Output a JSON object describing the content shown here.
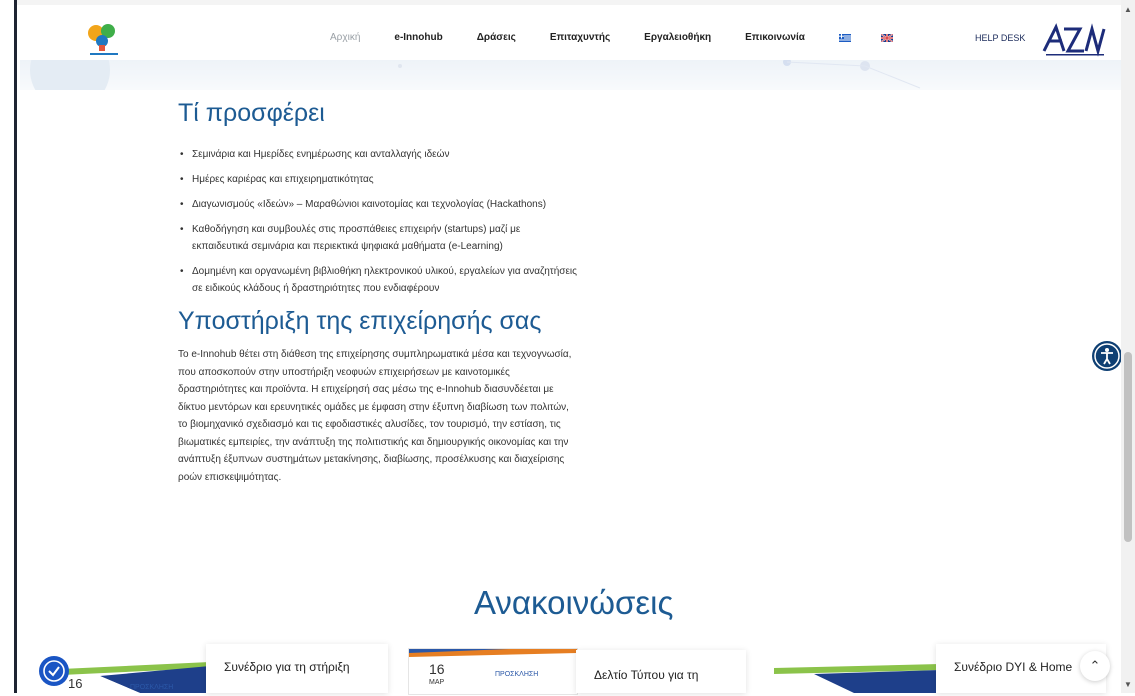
{
  "header": {
    "nav": [
      {
        "label": "Αρχική"
      },
      {
        "label": "e-Innohub"
      },
      {
        "label": "Δράσεις"
      },
      {
        "label": "Επιταχυντής"
      },
      {
        "label": "Εργαλειοθήκη"
      },
      {
        "label": "Επικοινωνία"
      }
    ],
    "languages": [
      "Greek",
      "English"
    ],
    "helpdesk_label": "HELP DESK"
  },
  "sections": {
    "offers": {
      "title": "Τί προσφέρει",
      "items": [
        "Σεμινάρια και Ημερίδες ενημέρωσης και ανταλλαγής ιδεών",
        "Ημέρες καριέρας και επιχειρηματικότητας",
        "Διαγωνισμούς «Ιδεών» – Μαραθώνιοι καινοτομίας και τεχνολογίας (Hackathons)",
        "Καθοδήγηση και συμβουλές στις προσπάθειες επιχειρήν (startups) μαζί με εκπαιδευτικά σεμινάρια και περιεκτικά ψηφιακά μαθήματα (e-Learning)",
        "Δομημένη και οργανωμένη βιβλιοθήκη ηλεκτρονικού υλικού, εργαλείων για αναζητήσεις σε ειδικούς κλάδους ή δραστηριότητες που ενδιαφέρουν"
      ]
    },
    "support": {
      "title": "Υποστήριξη της επιχείρησής σας",
      "text": "Το e-Innohub θέτει στη διάθεση της επιχείρησης συμπληρωματικά μέσα και τεχνογνωσία, που αποσκοπούν στην υποστήριξη νεοφυών επιχειρήσεων με καινοτομικές δραστηριότητες και προϊόντα. Η επιχείρησή σας μέσω της e-Innohub διασυνδέεται με δίκτυο μεντόρων και ερευνητικές ομάδες με έμφαση στην έξυπνη διαβίωση των πολιτών, το βιομηχανικό σχεδιασμό και τις εφοδιαστικές αλυσίδες, τον τουρισμό, την εστίαση, τις βιωματικές εμπειρίες, την ανάπτυξη της πολιτιστικής και δημιουργικής οικονομίας και την ανάπτυξη έξυπνων συστημάτων μετακίνησης, διαβίωσης, προσέλκυσης και διαχείρισης ροών επισκεψιμότητας."
    },
    "announcements": {
      "title": "Ανακοινώσεις",
      "cards": [
        {
          "date_day": "16",
          "date_month": "",
          "tag": "ΠΡΟΣΚΛΗΣΗ",
          "title": "Συνέδριο για τη στήριξη"
        },
        {
          "date_day": "16",
          "date_month": "MAP",
          "tag": "ΠΡΟΣΚΛΗΣΗ",
          "title": "Δελτίο Τύπου για τη"
        },
        {
          "date_day": "",
          "date_month": "",
          "tag": "",
          "title": "Συνέδριο DYI & Home"
        }
      ]
    }
  },
  "colors": {
    "heading": "#1d5b93",
    "nav_text": "#222222",
    "accessibility_button": "#0e3f73"
  }
}
